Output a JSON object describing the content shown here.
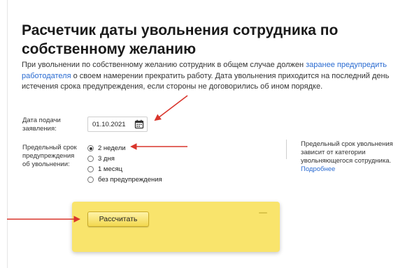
{
  "page": {
    "title": "Расчетчик даты увольнения сотрудника по собственному желанию",
    "intro": {
      "part1": "При увольнении по собственному желанию сотрудник в общем случае должен ",
      "link": "заранее предупредить работодателя",
      "part2": " о своем намерении прекратить работу. Дата увольнения приходится на последний день истечения срока предупреждения, если стороны не договорились об ином порядке."
    }
  },
  "form": {
    "date_label": "Дата подачи заявления:",
    "date_value": "01.10.2021",
    "limit_label": "Предельный срок предупреждения об увольнении:",
    "options": [
      {
        "label": "2 недели",
        "checked": true
      },
      {
        "label": "3 дня",
        "checked": false
      },
      {
        "label": "1 месяц",
        "checked": false
      },
      {
        "label": "без предупреждения",
        "checked": false
      }
    ]
  },
  "note": {
    "text": "Предельный срок увольнения зависит от категории увольняющегося сотрудника. ",
    "link": "Подробнее"
  },
  "actions": {
    "calculate_label": "Рассчитать"
  },
  "colors": {
    "link": "#2a6bd1",
    "panel": "#f9e46c",
    "annotation_arrow": "#d9352c"
  },
  "icons": {
    "date_picker": "calendar-icon"
  }
}
